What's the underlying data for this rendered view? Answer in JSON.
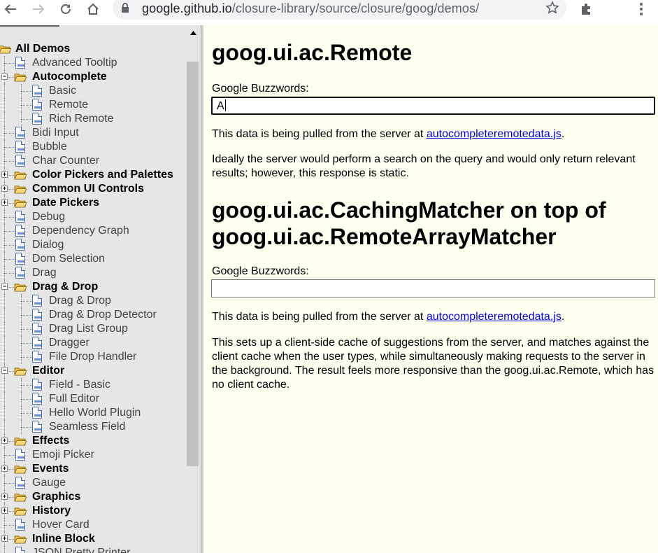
{
  "browser": {
    "url_host": "google.github.io",
    "url_path": "/closure-library/source/closure/goog/demos/"
  },
  "tree": {
    "items": [
      {
        "label": "All Demos",
        "type": "folder",
        "level": 0,
        "expander": "none"
      },
      {
        "label": "Advanced Tooltip",
        "type": "page",
        "level": 1
      },
      {
        "label": "Autocomplete",
        "type": "folder",
        "level": 1,
        "expander": "minus"
      },
      {
        "label": "Basic",
        "type": "page",
        "level": 2
      },
      {
        "label": "Remote",
        "type": "page",
        "level": 2
      },
      {
        "label": "Rich Remote",
        "type": "page",
        "level": 2
      },
      {
        "label": "Bidi Input",
        "type": "page",
        "level": 1
      },
      {
        "label": "Bubble",
        "type": "page",
        "level": 1
      },
      {
        "label": "Char Counter",
        "type": "page",
        "level": 1
      },
      {
        "label": "Color Pickers and Palettes",
        "type": "folder",
        "level": 1,
        "expander": "plus"
      },
      {
        "label": "Common UI Controls",
        "type": "folder",
        "level": 1,
        "expander": "plus"
      },
      {
        "label": "Date Pickers",
        "type": "folder",
        "level": 1,
        "expander": "plus"
      },
      {
        "label": "Debug",
        "type": "page",
        "level": 1
      },
      {
        "label": "Dependency Graph",
        "type": "page",
        "level": 1
      },
      {
        "label": "Dialog",
        "type": "page",
        "level": 1
      },
      {
        "label": "Dom Selection",
        "type": "page",
        "level": 1
      },
      {
        "label": "Drag",
        "type": "page",
        "level": 1
      },
      {
        "label": "Drag & Drop",
        "type": "folder",
        "level": 1,
        "expander": "minus"
      },
      {
        "label": "Drag & Drop",
        "type": "page",
        "level": 2
      },
      {
        "label": "Drag & Drop Detector",
        "type": "page",
        "level": 2
      },
      {
        "label": "Drag List Group",
        "type": "page",
        "level": 2
      },
      {
        "label": "Dragger",
        "type": "page",
        "level": 2
      },
      {
        "label": "File Drop Handler",
        "type": "page",
        "level": 2
      },
      {
        "label": "Editor",
        "type": "folder",
        "level": 1,
        "expander": "minus"
      },
      {
        "label": "Field - Basic",
        "type": "page",
        "level": 2
      },
      {
        "label": "Full Editor",
        "type": "page",
        "level": 2
      },
      {
        "label": "Hello World Plugin",
        "type": "page",
        "level": 2
      },
      {
        "label": "Seamless Field",
        "type": "page",
        "level": 2
      },
      {
        "label": "Effects",
        "type": "folder",
        "level": 1,
        "expander": "plus"
      },
      {
        "label": "Emoji Picker",
        "type": "page",
        "level": 1
      },
      {
        "label": "Events",
        "type": "folder",
        "level": 1,
        "expander": "plus"
      },
      {
        "label": "Gauge",
        "type": "page",
        "level": 1
      },
      {
        "label": "Graphics",
        "type": "folder",
        "level": 1,
        "expander": "plus"
      },
      {
        "label": "History",
        "type": "folder",
        "level": 1,
        "expander": "plus"
      },
      {
        "label": "Hover Card",
        "type": "page",
        "level": 1
      },
      {
        "label": "Inline Block",
        "type": "folder",
        "level": 1,
        "expander": "plus"
      },
      {
        "label": "JSON Pretty Printer",
        "type": "page",
        "level": 1
      }
    ]
  },
  "main": {
    "section1": {
      "title": "goog.ui.ac.Remote",
      "field_label": "Google Buzzwords:",
      "field_value": "A",
      "para1_prefix": "This data is being pulled from the server at ",
      "para1_link": "autocompleteremotedata.js",
      "para1_suffix": ".",
      "para2": "Ideally the server would perform a search on the query and would only return relevant results; however, this response is static."
    },
    "section2": {
      "title_line1": "goog.ui.ac.CachingMatcher on top of",
      "title_line2": "goog.ui.ac.RemoteArrayMatcher",
      "field_label": "Google Buzzwords:",
      "field_value": "",
      "para1_prefix": "This data is being pulled from the server at ",
      "para1_link": "autocompleteremotedata.js",
      "para1_suffix": ".",
      "para2": "This sets up a client-side cache of suggestions from the server, and matches against the client cache when the user types, while simultaneously making requests to the server in the background. The result feels more responsive than the goog.ui.ac.Remote, which has no client cache."
    }
  }
}
